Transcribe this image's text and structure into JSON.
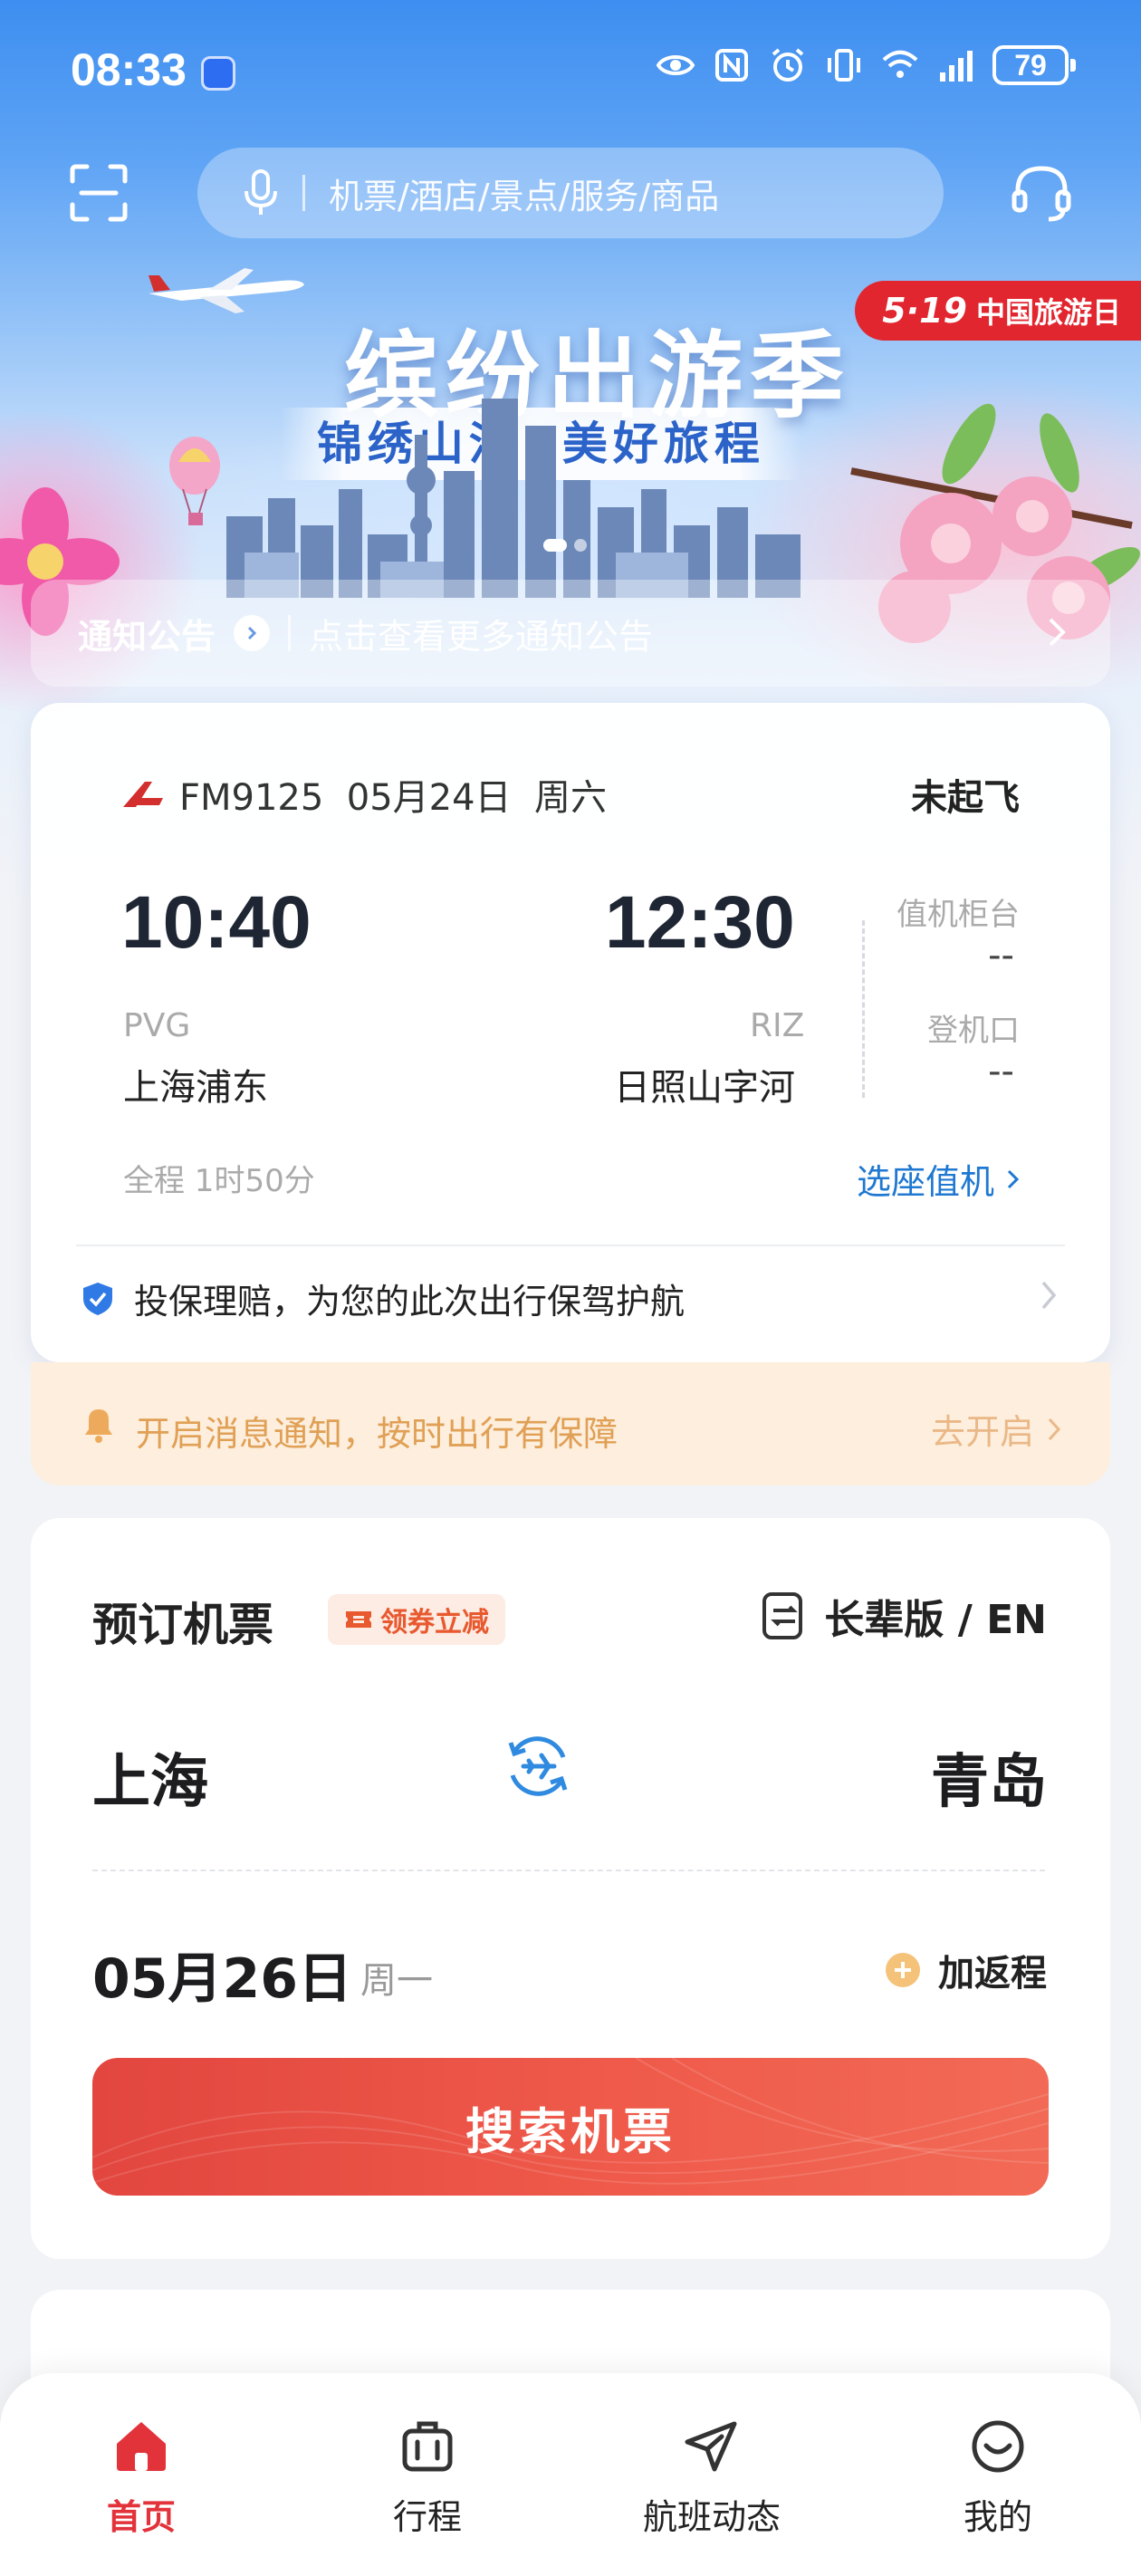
{
  "status_bar": {
    "time": "08:33",
    "battery": "79"
  },
  "search": {
    "placeholder": "机票/酒店/景点/服务/商品"
  },
  "banner": {
    "title": "缤纷出游季",
    "subtitle": "锦绣山河  美好旅程",
    "badge_date": "5·19",
    "badge_text": "中国旅游日"
  },
  "notice": {
    "title": "通知公告",
    "text": "点击查看更多通知公告"
  },
  "flight": {
    "flight_no": "FM9125  05月24日  周六",
    "status": "未起飞",
    "dep_time": "10:40",
    "arr_time": "12:30",
    "dep_code": "PVG",
    "arr_code": "RIZ",
    "dep_airport": "上海浦东",
    "arr_airport": "日照山字河",
    "checkin_counter_label": "值机柜台",
    "checkin_counter_value": "--",
    "gate_label": "登机口",
    "gate_value": "--",
    "duration": "全程 1时50分",
    "seat_link": "选座值机",
    "insurance_text": "投保理赔，为您的此次出行保驾护航"
  },
  "notify": {
    "text": "开启消息通知，按时出行有保障",
    "link": "去开启"
  },
  "booking": {
    "title": "预订机票",
    "coupon": "领券立减",
    "elder_mode": "长辈版 / EN",
    "from_city": "上海",
    "to_city": "青岛",
    "date": "05月26日",
    "weekday": "周一",
    "add_return": "加返程",
    "search_button": "搜索机票"
  },
  "nav": {
    "items": [
      {
        "label": "首页",
        "icon": "home-icon",
        "active": true
      },
      {
        "label": "行程",
        "icon": "luggage-icon",
        "active": false
      },
      {
        "label": "航班动态",
        "icon": "paper-plane-icon",
        "active": false
      },
      {
        "label": "我的",
        "icon": "smiley-icon",
        "active": false
      }
    ]
  },
  "colors": {
    "brand_red": "#e2323a",
    "link_blue": "#1f78d1",
    "notify_orange": "#e0a055"
  }
}
